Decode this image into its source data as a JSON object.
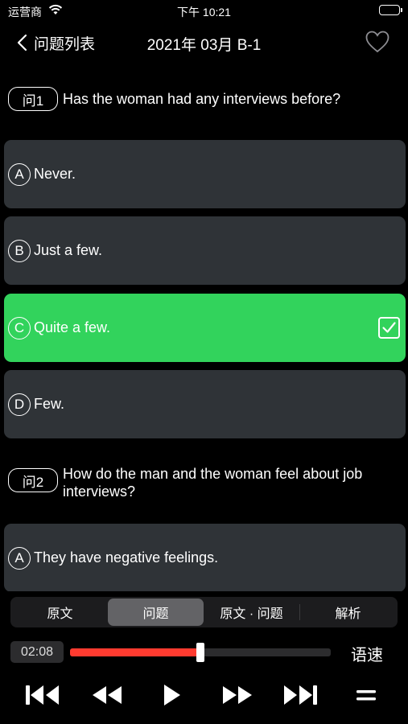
{
  "status_bar": {
    "carrier": "运营商",
    "time": "下午 10:21"
  },
  "nav": {
    "back_label": "问题列表",
    "title": "2021年 03月 B-1"
  },
  "questions": [
    {
      "badge": "问1",
      "text": "Has the woman had any interviews before?",
      "options": [
        {
          "letter": "A",
          "text": "Never."
        },
        {
          "letter": "B",
          "text": "Just a few."
        },
        {
          "letter": "C",
          "text": "Quite a few.",
          "selected": true
        },
        {
          "letter": "D",
          "text": "Few."
        }
      ]
    },
    {
      "badge": "问2",
      "text": "How do the man and the woman feel about job interviews?",
      "options": [
        {
          "letter": "A",
          "text": "They have negative feelings."
        }
      ]
    }
  ],
  "tabs": [
    "原文",
    "问题",
    "原文 · 问题",
    "解析"
  ],
  "active_tab": "问题",
  "player": {
    "current_time": "02:08",
    "progress": 0.5,
    "speed_label": "语速"
  },
  "colors": {
    "selected": "#32d35c",
    "option_bg": "#2f3337",
    "progress": "#ff3b30"
  }
}
